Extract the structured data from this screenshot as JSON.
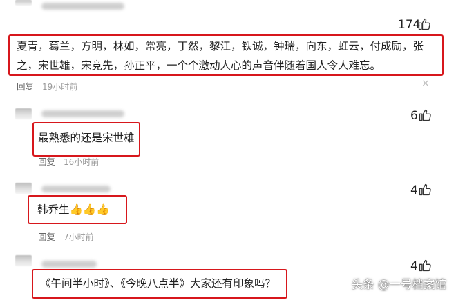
{
  "comments": [
    {
      "likes": "174",
      "text": "夏青，葛兰，方明，林如，常亮，丁然，黎江，铁诚，钟瑞，向东，虹云，付成励，张之，宋世雄，宋竞先，孙正平，一个个激动人心的声音伴随着国人令人难忘。",
      "reply_label": "回复",
      "time": "19小时前",
      "more": "×"
    },
    {
      "likes": "6",
      "text": "最熟悉的还是宋世雄",
      "reply_label": "回复",
      "time": "16小时前"
    },
    {
      "likes": "4",
      "text": "韩乔生👍👍👍",
      "reply_label": "回复",
      "time": "7小时前"
    },
    {
      "likes": "4",
      "text": "《午间半小时》、《今晚八点半》大家还有印象吗？"
    }
  ],
  "watermark": "头条 @一号档案馆",
  "colors": {
    "highlight_box": "#d7171c",
    "meta_text": "#999999"
  },
  "icons": {
    "like": "thumbs-up-icon",
    "close": "close-icon"
  }
}
